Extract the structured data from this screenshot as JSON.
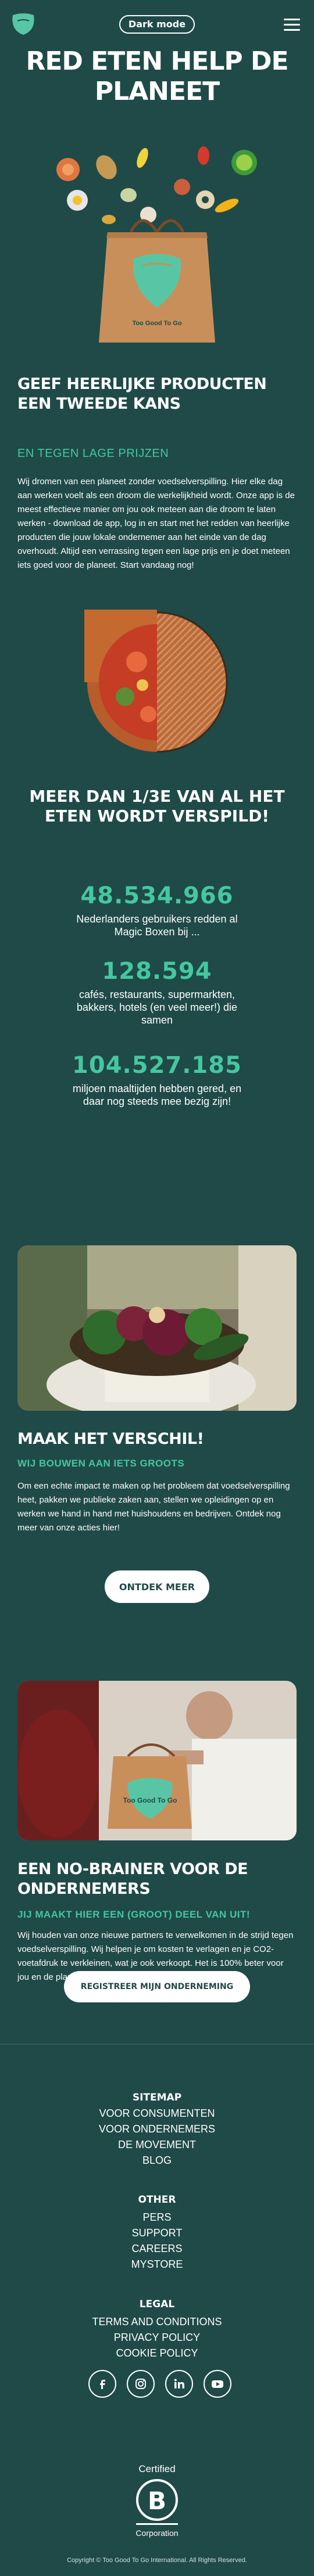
{
  "header": {
    "mode_toggle": "Dark mode",
    "colors": {
      "background": "#1f4a47",
      "accent": "#45c7a0",
      "logo": "#58c6a5"
    }
  },
  "hero": {
    "title": "RED ETEN HELP DE PLANEET",
    "bag_text": "Too Good To Go"
  },
  "intro": {
    "title": "GEEF HEERLIJKE PRODUCTEN EEN TWEEDE KANS",
    "subtitle": "EN TEGEN LAGE PRIJZEN",
    "body": "Wij dromen van een planeet zonder voedselverspilling. Hier elke dag aan werken voelt als een droom die werkelijkheid wordt. Onze app is de meest effectieve manier om jou ook meteen aan die droom te laten werken - download de app, log in en start met het redden van heerlijke producten die jouw lokale ondernemer aan het einde van de dag overhoudt. Altijd een verrassing tegen een lage prijs en je doet meteen iets goed voor de planeet. Start vandaag nog!"
  },
  "stats": {
    "title": "MEER DAN 1/3E VAN AL HET ETEN WORDT VERSPILD!",
    "items": [
      {
        "number": "48.534.966",
        "label": "Nederlanders gebruikers redden al Magic Boxen bij ..."
      },
      {
        "number": "128.594",
        "label": "cafés, restaurants, supermarkten, bakkers, hotels (en veel meer!) die samen"
      },
      {
        "number": "104.527.185",
        "label": "miljoen maaltijden hebben gered, en daar nog steeds mee bezig zijn!"
      }
    ]
  },
  "difference": {
    "title": "MAAK HET VERSCHIL!",
    "subtitle": "WIJ BOUWEN AAN IETS GROOTS",
    "body": "Om een echte impact te maken op het probleem dat voedselverspilling heet, pakken we publieke zaken aan, stellen we opleidingen op en werken we hand in hand met huishoudens en bedrijven. Ontdek nog meer van onze acties hier!",
    "button": "ONTDEK MEER"
  },
  "business": {
    "title": "EEN NO-BRAINER VOOR DE ONDERNEMERS",
    "subtitle": "JIJ MAAKT HIER EEN (GROOT) DEEL VAN UIT!",
    "body": "Wij houden van onze nieuwe partners te verwelkomen in de strijd tegen voedselverspilling. Wij helpen je om kosten te verlagen en je CO2-voetafdruk te verkleinen, wat je ook verkoopt. Het is 100% beter voor jou en de planeet.",
    "button": "REGISTREER MIJN ONDERNEMING",
    "bag_text": "Too Good To Go"
  },
  "footer": {
    "sitemap_heading": "SITEMAP",
    "sitemap_links": [
      "VOOR CONSUMENTEN",
      "VOOR ONDERNEMERS",
      "DE MOVEMENT",
      "BLOG"
    ],
    "other_heading": "OTHER",
    "other_links": [
      "PERS",
      "SUPPORT",
      "CAREERS",
      "MYSTORE"
    ],
    "legal_heading": "LEGAL",
    "legal_links": [
      "TERMS AND CONDITIONS",
      "PRIVACY POLICY",
      "COOKIE POLICY"
    ],
    "social": [
      "facebook-icon",
      "instagram-icon",
      "linkedin-icon",
      "youtube-icon"
    ],
    "bcorp": {
      "top": "Certified",
      "bottom": "Corporation"
    },
    "copyright": "Copyright © Too Good To Go International. All Rights Reserved."
  }
}
